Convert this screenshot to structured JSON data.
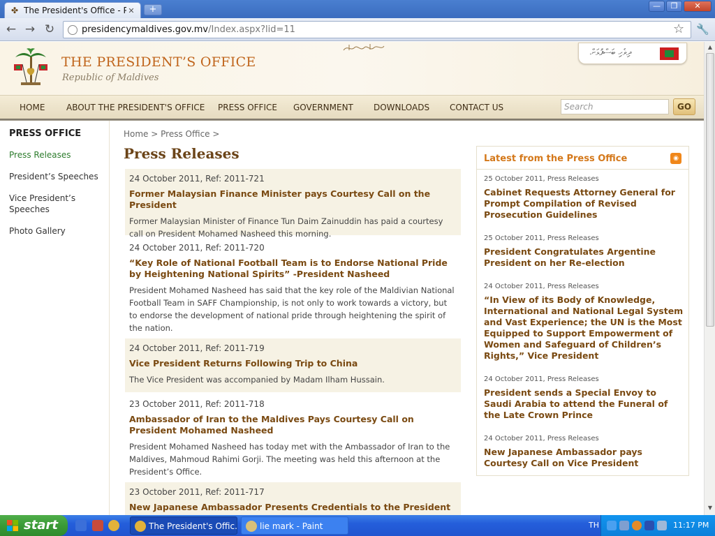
{
  "browser": {
    "tab_title": "The President's Office - Press R",
    "tab_close": "✕",
    "new_tab": "+",
    "url_host": "presidencymaldives.gov.mv",
    "url_path": "/Index.aspx?lid=11"
  },
  "header": {
    "title": "THE PRESIDENT’S OFFICE",
    "subtitle": "Republic of Maldives",
    "lang_label": "ދިވެހި ބަސްފުޅަށް"
  },
  "nav": {
    "items": [
      "HOME",
      "ABOUT THE PRESIDENT'S OFFICE",
      "PRESS OFFICE",
      "GOVERNMENT",
      "DOWNLOADS",
      "CONTACT US"
    ],
    "search_placeholder": "Search",
    "go_label": "GO"
  },
  "sidebar": {
    "heading": "PRESS OFFICE",
    "items": [
      "Press Releases",
      "President’s Speeches",
      "Vice President’s Speeches",
      "Photo Gallery"
    ]
  },
  "main": {
    "breadcrumb": "Home > Press Office >",
    "page_title": "Press Releases",
    "releases": [
      {
        "date": "24 October 2011, Ref: 2011-721",
        "title": "Former Malaysian Finance Minister pays Courtesy Call on the President",
        "summary": "Former Malaysian Minister of Finance Tun Daim Zainuddin has paid a courtesy call on President Mohamed Nasheed this morning."
      },
      {
        "date": "24 October 2011, Ref: 2011-720",
        "title": "“Key Role of National Football Team is to Endorse National Pride by Heightening National Spirits” -President Nasheed",
        "summary": "President Mohamed Nasheed has said that the key role of the Maldivian National Football Team in SAFF Championship, is not only to work towards a victory, but to endorse the development of national pride through heightening the spirit of the nation."
      },
      {
        "date": "24 October 2011, Ref: 2011-719",
        "title": "Vice President Returns Following Trip to China",
        "summary": "The Vice President was accompanied by Madam Ilham Hussain."
      },
      {
        "date": "23 October 2011, Ref: 2011-718",
        "title": "Ambassador of Iran to the Maldives Pays Courtesy Call on President Mohamed Nasheed",
        "summary": "President Mohamed Nasheed has today met with the Ambassador of Iran to the Maldives, Mahmoud Rahimi Gorji. The meeting was held this afternoon at the President’s Office."
      },
      {
        "date": "23 October 2011, Ref: 2011-717",
        "title": "New Japanese Ambassador Presents Credentials to the President",
        "summary": ""
      }
    ]
  },
  "latest": {
    "heading": "Latest from the Press Office",
    "items": [
      {
        "meta": "25 October 2011, Press Releases",
        "title": "Cabinet Requests Attorney General for Prompt Compilation of Revised Prosecution Guidelines"
      },
      {
        "meta": "25 October 2011, Press Releases",
        "title": "President Congratulates Argentine President on her Re-election"
      },
      {
        "meta": "24 October 2011, Press Releases",
        "title": "“In View of its Body of Knowledge, International and National Legal System and Vast Experience; the UN is the Most Equipped to Support Empowerment of Women and Safeguard of Children’s Rights,” Vice President"
      },
      {
        "meta": "24 October 2011, Press Releases",
        "title": "President sends a Special Envoy to Saudi Arabia to attend the Funeral of the Late Crown Prince"
      },
      {
        "meta": "24 October 2011, Press Releases",
        "title": "New Japanese Ambassador pays Courtesy Call on Vice President"
      }
    ]
  },
  "taskbar": {
    "start_label": "start",
    "tasks": [
      "The President's Offic...",
      "lie mark - Paint"
    ],
    "lang": "TH",
    "clock": "11:17 PM"
  },
  "colors": {
    "accent_orange": "#c0651c",
    "link_brown": "#7a4a12",
    "active_green": "#2d7c2d",
    "shade": "#f6f2e4"
  },
  "icons": [
    "page-icon",
    "back-icon",
    "forward-icon",
    "reload-icon",
    "star-icon",
    "wrench-icon",
    "rss-icon",
    "flag-icon",
    "emblem-icon",
    "windows-logo-icon"
  ]
}
